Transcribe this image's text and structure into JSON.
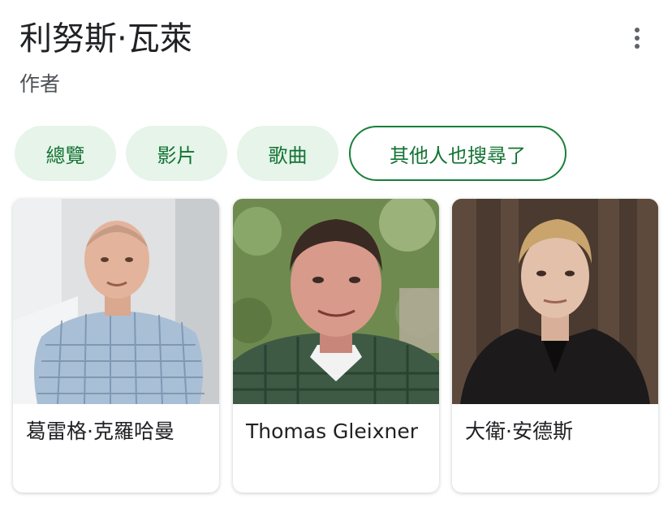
{
  "header": {
    "title": "利努斯·瓦萊",
    "subtitle": "作者",
    "more_icon": "more-vertical-icon"
  },
  "chips": [
    {
      "label": "總覽",
      "selected": false
    },
    {
      "label": "影片",
      "selected": false
    },
    {
      "label": "歌曲",
      "selected": false
    },
    {
      "label": "其他人也搜尋了",
      "selected": true
    }
  ],
  "people": [
    {
      "name": "葛雷格·克羅哈曼"
    },
    {
      "name": "Thomas Gleixner"
    },
    {
      "name": "大衛·安德斯"
    }
  ],
  "colors": {
    "chip_bg": "#e6f4ea",
    "chip_text": "#137333",
    "chip_border_selected": "#188038",
    "title_text": "#202124",
    "subtitle_text": "#4d5156"
  }
}
